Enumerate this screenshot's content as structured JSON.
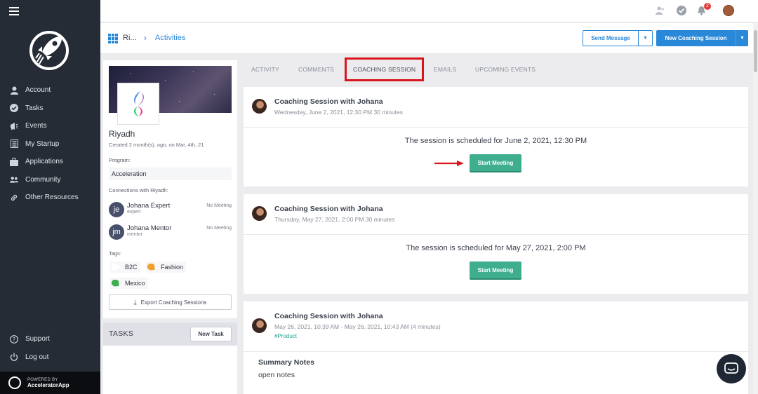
{
  "sidebar": {
    "items": [
      {
        "label": "Account",
        "icon": "user-icon"
      },
      {
        "label": "Tasks",
        "icon": "check-circle-icon"
      },
      {
        "label": "Events",
        "icon": "megaphone-icon"
      },
      {
        "label": "My Startup",
        "icon": "building-icon"
      },
      {
        "label": "Applications",
        "icon": "briefcase-icon"
      },
      {
        "label": "Community",
        "icon": "users-icon"
      },
      {
        "label": "Other Resources",
        "icon": "link-icon"
      }
    ],
    "bottom": [
      {
        "label": "Support",
        "icon": "question-circle-icon"
      },
      {
        "label": "Log out",
        "icon": "power-icon"
      }
    ],
    "powered_small": "POWERED BY",
    "powered_brand": "AcceleratorApp"
  },
  "topbar": {
    "notification_count": "2"
  },
  "breadcrumb": {
    "first": "Ri...",
    "separator": "›",
    "active": "Activities"
  },
  "actions": {
    "send_message": "Send Message",
    "new_coaching_session": "New Coaching Session"
  },
  "profile": {
    "name": "Riyadh",
    "created": "Created 2 month(s), ago, on Mar, 4th, 21",
    "program_label": "Program:",
    "program_value": "Acceleration",
    "connections_label": "Connections with Riyadh:",
    "connections": [
      {
        "initials": "je",
        "name": "Johana Expert",
        "role": "expert",
        "meeting": "No Meeting"
      },
      {
        "initials": "jm",
        "name": "Johana Mentor",
        "role": "mentor",
        "meeting": "No Meeting"
      }
    ],
    "tags_label": "Tags:",
    "tags": [
      {
        "label": "B2C",
        "color": "#ffffff"
      },
      {
        "label": "Fashion",
        "color": "#f0a030"
      },
      {
        "label": "Mexico",
        "color": "#3fae4f"
      }
    ],
    "export_label": "Export Coaching Sessions"
  },
  "tasks": {
    "title": "TASKS",
    "new_task": "New Task"
  },
  "tabs": [
    {
      "label": "ACTIVITY"
    },
    {
      "label": "COMMENTS"
    },
    {
      "label": "COACHING SESSION"
    },
    {
      "label": "EMAILS"
    },
    {
      "label": "UPCOMING EVENTS"
    }
  ],
  "sessions": [
    {
      "title": "Coaching Session with Johana",
      "date": "Wednesday, June 2, 2021, 12:30 PM 30 minutes",
      "message": "The session is scheduled for June 2, 2021, 12:30 PM",
      "button": "Start Meeting"
    },
    {
      "title": "Coaching Session with Johana",
      "date": "Thursday, May 27, 2021, 2:00 PM 30 minutes",
      "message": "The session is scheduled for May 27, 2021, 2:00 PM",
      "button": "Start Meeting"
    },
    {
      "title": "Coaching Session with Johana",
      "date": "May 26, 2021, 10:39 AM - May 26, 2021, 10:43 AM (4 minutes)",
      "tag": "#Product",
      "notes_title": "Summary Notes",
      "notes_text": "open notes"
    }
  ],
  "colors": {
    "accent": "#2a88d8",
    "sidebar": "#262c36",
    "start_button": "#3fae8f",
    "highlight": "#d9151b"
  }
}
